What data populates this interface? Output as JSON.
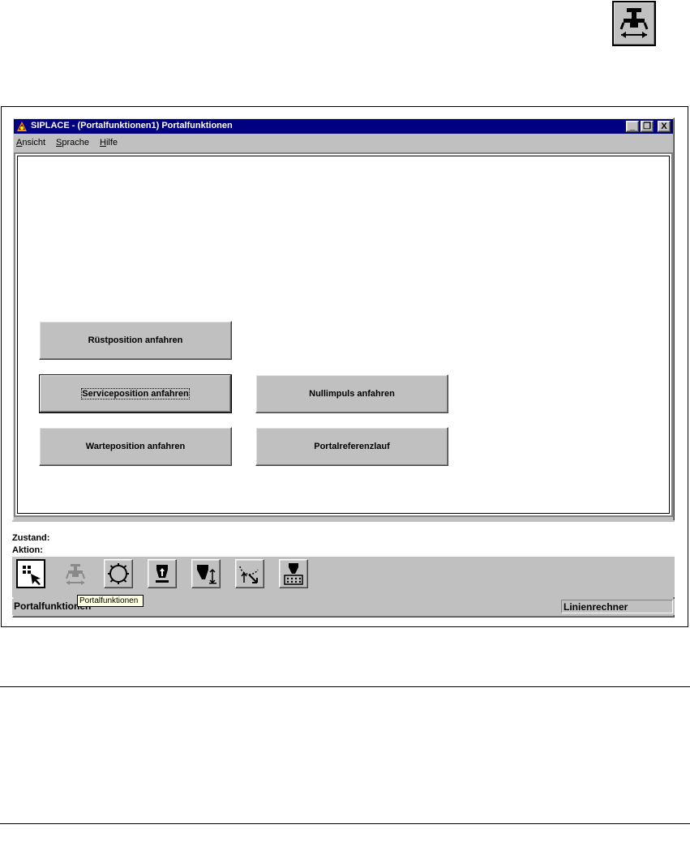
{
  "top_icon": {
    "name": "portal-functions-icon"
  },
  "window": {
    "title": "SIPLACE - (Portalfunktionen1) Portalfunktionen",
    "controls": {
      "minimize": "_",
      "restore": "❐",
      "close": "X"
    }
  },
  "menu": {
    "items": [
      {
        "label": "Ansicht",
        "accel": "A",
        "rest": "nsicht"
      },
      {
        "label": "Sprache",
        "accel": "S",
        "rest": "prache"
      },
      {
        "label": "Hilfe",
        "accel": "H",
        "rest": "ilfe"
      }
    ]
  },
  "buttons": {
    "ruestposition": "Rüstposition anfahren",
    "serviceposition": "Serviceposition anfahren",
    "nullimpuls": "Nullimpuls anfahren",
    "warteposition": "Warteposition anfahren",
    "portalreferenzlauf": "Portalreferenzlauf"
  },
  "status": {
    "zustand_label": "Zustand:",
    "aktion_label": "Aktion:"
  },
  "toolbar": {
    "tools": [
      {
        "name": "select-view-icon"
      },
      {
        "name": "portal-functions-icon",
        "disabled": true
      },
      {
        "name": "gear-cycle-icon"
      },
      {
        "name": "nozzle-up-icon"
      },
      {
        "name": "nozzle-height-icon"
      },
      {
        "name": "rotate-arrow-icon"
      },
      {
        "name": "feeder-matrix-icon"
      }
    ],
    "tooltip": "Portalfunktionen"
  },
  "statusbar": {
    "left": "Portalfunktionen",
    "right": "Linienrechner"
  }
}
